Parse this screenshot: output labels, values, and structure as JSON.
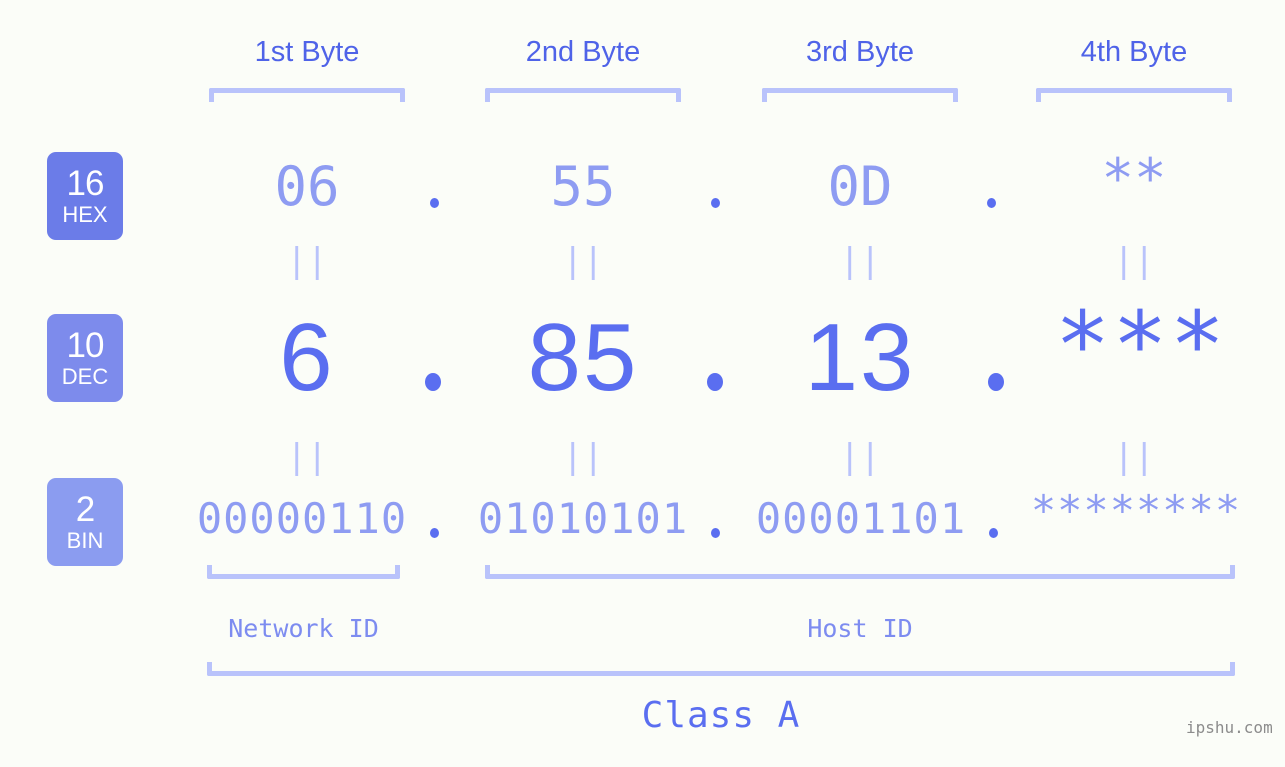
{
  "page": {
    "background_color": "#fbfdf8",
    "accent_color": "#5a6ef0",
    "light_accent_color": "#8e9cf2",
    "bracket_color": "#b9c3fb"
  },
  "byte_headers": [
    {
      "label": "1st Byte"
    },
    {
      "label": "2nd Byte"
    },
    {
      "label": "3rd Byte"
    },
    {
      "label": "4th Byte"
    }
  ],
  "bases": [
    {
      "number": "16",
      "name": "HEX",
      "color": "#6b7ce8"
    },
    {
      "number": "10",
      "name": "DEC",
      "color": "#7d8bec"
    },
    {
      "number": "2",
      "name": "BIN",
      "color": "#8b9cf0"
    }
  ],
  "rows": {
    "hex": {
      "base_number": "16",
      "base_name": "HEX",
      "octets": [
        "06",
        "55",
        "0D",
        "**"
      ],
      "separator": "."
    },
    "dec": {
      "base_number": "10",
      "base_name": "DEC",
      "octets": [
        "6",
        "85",
        "13",
        "***"
      ],
      "separator": "."
    },
    "bin": {
      "base_number": "2",
      "base_name": "BIN",
      "octets": [
        "00000110",
        "01010101",
        "00001101",
        "********"
      ],
      "separator": "."
    }
  },
  "equals_marks": {
    "glyph": "||",
    "hex_to_dec": [
      "||",
      "||",
      "||",
      "||"
    ],
    "dec_to_bin": [
      "||",
      "||",
      "||",
      "||"
    ]
  },
  "footer": {
    "network_id_label": "Network ID",
    "host_id_label": "Host ID",
    "class_label": "Class A",
    "watermark": "ipshu.com"
  }
}
